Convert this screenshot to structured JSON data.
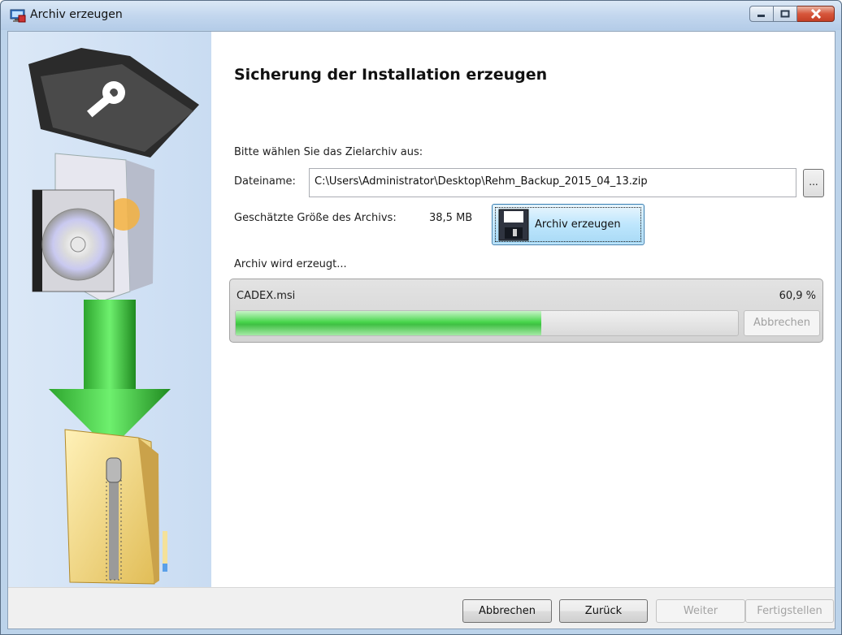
{
  "window": {
    "title": "Archiv erzeugen"
  },
  "main": {
    "heading": "Sicherung der Installation erzeugen",
    "prompt": "Bitte wählen Sie das Zielarchiv aus:",
    "filename_label": "Dateiname:",
    "filename_value": "C:\\Users\\Administrator\\Desktop\\Rehm_Backup_2015_04_13.zip",
    "browse_label": "...",
    "size_label": "Geschätzte Größe des Archivs:",
    "size_value": "38,5 MB",
    "create_button": "Archiv erzeugen",
    "progress_label": "Archiv wird erzeugt...",
    "current_file": "CADEX.msi",
    "percent_text": "60,9 %",
    "progress_fraction": 0.609,
    "progress_abort": "Abbrechen"
  },
  "footer": {
    "cancel": "Abbrechen",
    "back": "Zurück",
    "next": "Weiter",
    "finish": "Fertigstellen"
  },
  "icons": {
    "sidebar": [
      "key-folder-icon",
      "software-box-icon",
      "download-arrow-icon",
      "zip-folder-icon"
    ]
  },
  "colors": {
    "progress": "#48d64c",
    "sidebar": "#dbe8f7",
    "close": "#d7563b"
  }
}
